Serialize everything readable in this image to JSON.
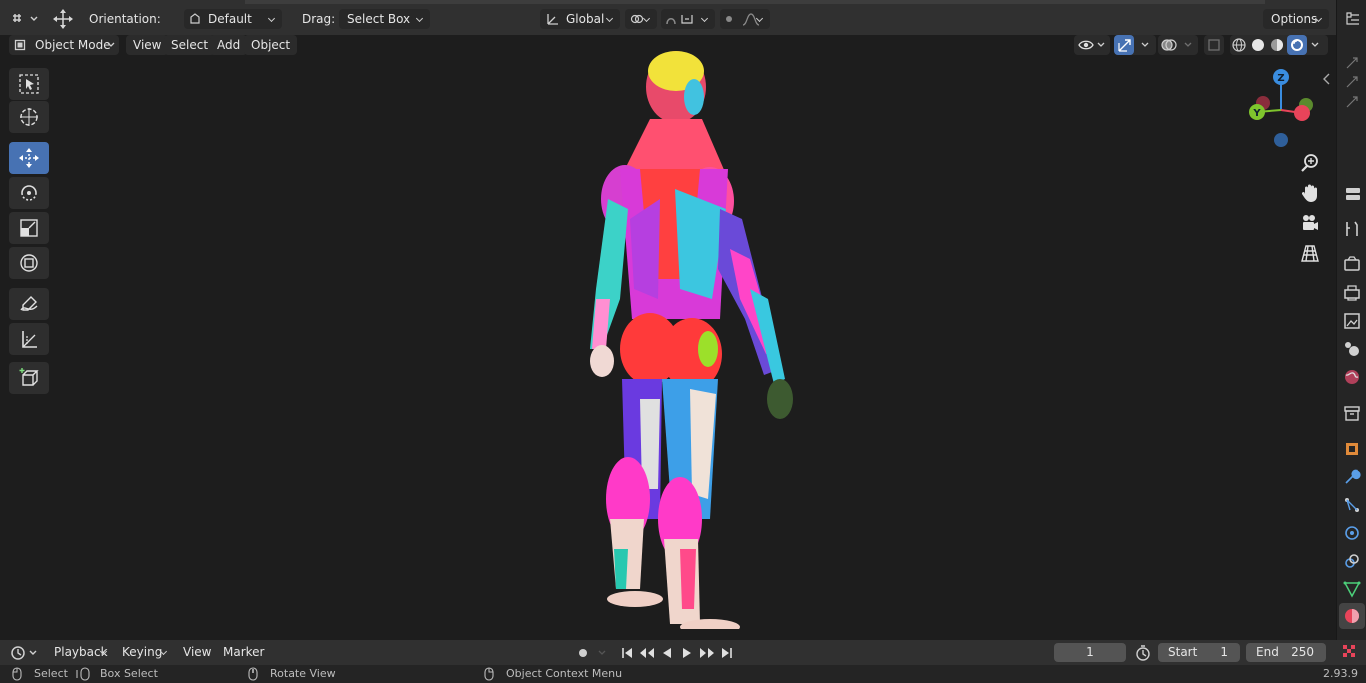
{
  "header": {
    "orientation_label": "Orientation:",
    "orientation_value": "Default",
    "drag_label": "Drag:",
    "drag_value": "Select Box",
    "transform_space": "Global",
    "options_label": "Options"
  },
  "viewport_header": {
    "mode": "Object Mode",
    "menus": [
      "View",
      "Select",
      "Add",
      "Object"
    ]
  },
  "gizmo": {
    "z": "Z",
    "y": "Y"
  },
  "timeline": {
    "menus": [
      "Playback",
      "Keying",
      "View",
      "Marker"
    ],
    "current_frame": "1",
    "start_label": "Start",
    "start_value": "1",
    "end_label": "End",
    "end_value": "250"
  },
  "statusbar": {
    "select": "Select",
    "box_select": "Box Select",
    "rotate_view": "Rotate View",
    "context_menu": "Object Context Menu",
    "version": "2.93.9"
  },
  "colors": {
    "accent": "#4772b3",
    "axis_x": "#e8445a",
    "axis_y": "#7fc52d",
    "axis_z": "#3a8de0"
  },
  "icons": [
    "editor-type-icon",
    "transform-gizmo-icon",
    "orientation-icon",
    "transform-pivot-icon",
    "snap-icon",
    "proportional-icon",
    "visibility-icon",
    "gizmo-icon",
    "overlay-icon",
    "xray-icon",
    "wireframe-shading-icon",
    "solid-shading-icon",
    "material-shading-icon",
    "rendered-shading-icon",
    "zoom-icon",
    "hand-pan-icon",
    "camera-icon",
    "ortho-grid-icon"
  ]
}
